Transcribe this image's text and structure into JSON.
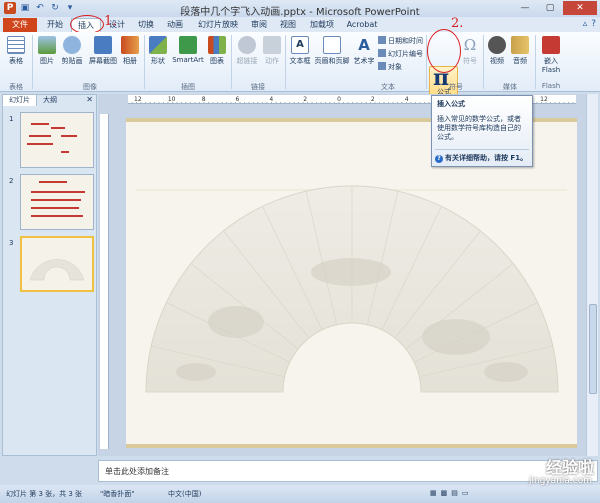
{
  "window": {
    "title": "段落中几个字飞入动画.pptx - Microsoft PowerPoint"
  },
  "tabs": {
    "file": "文件",
    "items": [
      "开始",
      "插入",
      "设计",
      "切换",
      "动画",
      "幻灯片放映",
      "审阅",
      "视图",
      "加载项",
      "Acrobat"
    ],
    "active": "插入"
  },
  "annotations": {
    "step1": "1.",
    "step2": "2."
  },
  "ribbon": {
    "buttons": {
      "table": "表格",
      "picture": "图片",
      "clipart": "剪贴画",
      "screenshot": "屏幕截图",
      "album": "相册",
      "shapes": "形状",
      "smartart": "SmartArt",
      "chart": "图表",
      "hyperlink": "超链接",
      "action": "动作",
      "textbox": "文本框",
      "headerfooter": "页眉和页脚",
      "wordart": "艺术字",
      "datetime": "日期和时间",
      "slidenumber": "幻灯片编号",
      "object": "对象",
      "equation": "公式",
      "symbol": "符号",
      "video": "视频",
      "audio": "音频",
      "flash_line1": "嵌入",
      "flash_line2": "Flash"
    },
    "groups": {
      "tables": "表格",
      "images": "图像",
      "illustrations": "插图",
      "links": "链接",
      "text": "文本",
      "symbols": "符号",
      "media": "媒体",
      "flash": "Flash"
    }
  },
  "tooltip": {
    "title": "插入公式",
    "body": "插入常见的数学公式，或者使用数学符号库构造自己的公式。",
    "help": "有关详细帮助，请按 F1。"
  },
  "leftpanel": {
    "tab_slides": "幻灯片",
    "tab_outline": "大纲",
    "slide_numbers": [
      "1",
      "2",
      "3"
    ]
  },
  "ruler": {
    "h_labels": [
      "12",
      "10",
      "8",
      "6",
      "4",
      "2",
      "0",
      "2",
      "4",
      "6",
      "8",
      "10",
      "12"
    ],
    "h_right": "12"
  },
  "notes": {
    "placeholder": "单击此处添加备注"
  },
  "statusbar": {
    "slide_info": "幻灯片 第 3 张，共 3 张",
    "theme": "\"暗香扑面\"",
    "language": "中文(中国)"
  },
  "watermark": {
    "text": "经验啦",
    "url": "jingyanla.com"
  }
}
